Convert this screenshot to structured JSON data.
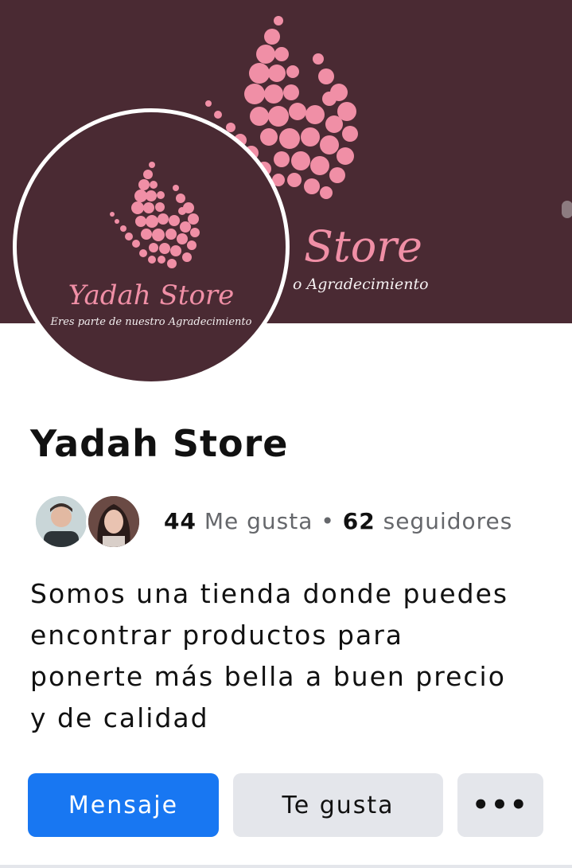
{
  "cover": {
    "brand_text": "Store",
    "tagline_text": "o Agradecimiento"
  },
  "avatar": {
    "brand_text": "Yadah Store",
    "tagline_text": "Eres parte de nuestro Agradecimiento"
  },
  "page": {
    "name": "Yadah Store",
    "likes_count": "44",
    "likes_label": "Me gusta",
    "separator": "•",
    "followers_count": "62",
    "followers_label": "seguidores",
    "about_lines": [
      "Somos una tienda donde puedes",
      "encontrar productos para",
      "ponerte más bella a buen precio",
      "y de calidad"
    ]
  },
  "actions": {
    "message_label": "Mensaje",
    "like_label": "Te gusta",
    "more_label": "•••"
  },
  "colors": {
    "cover_bg": "#4a2a33",
    "brand_pink": "#f08fa6",
    "primary_blue": "#1877f2",
    "secondary_btn": "#e4e6eb"
  }
}
